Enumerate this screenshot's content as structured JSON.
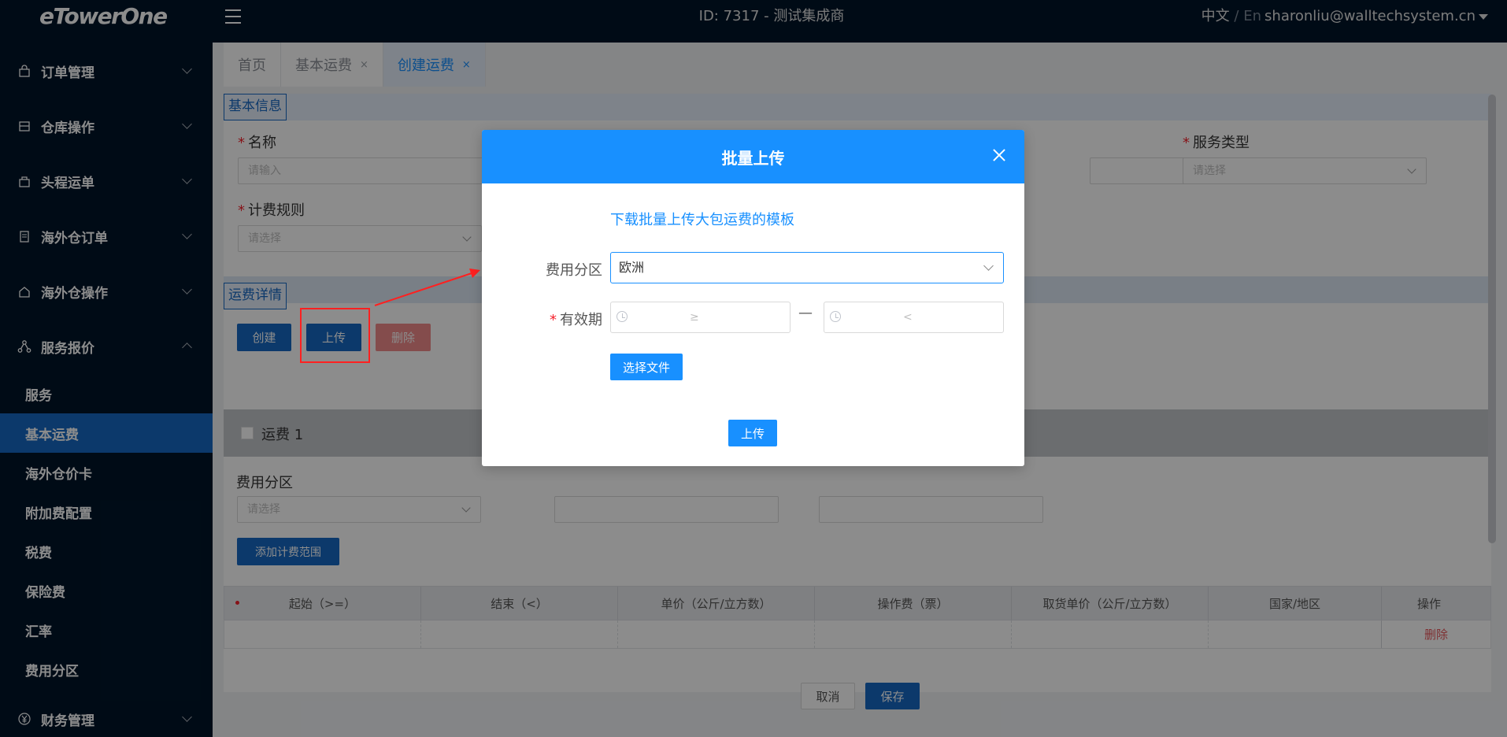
{
  "app": {
    "logo": "eTowerOne",
    "id_title": "ID: 7317 - 测试集成商"
  },
  "header": {
    "lang_zh": "中文",
    "lang_sep": "/",
    "lang_en": "En",
    "user_email": "sharonliu@walltechsystem.cn"
  },
  "sidebar": {
    "items": [
      {
        "label": "订单管理",
        "icon": "lock-icon"
      },
      {
        "label": "仓库操作",
        "icon": "box-icon"
      },
      {
        "label": "头程运单",
        "icon": "bag-icon"
      },
      {
        "label": "海外仓订单",
        "icon": "document-icon"
      },
      {
        "label": "海外仓操作",
        "icon": "house-icon"
      },
      {
        "label": "服务报价",
        "icon": "network-icon"
      }
    ],
    "subitems": [
      "服务",
      "基本运费",
      "海外仓价卡",
      "附加费配置",
      "税费",
      "保险费",
      "汇率",
      "费用分区"
    ],
    "active_subitem": "基本运费",
    "bottom_item": {
      "label": "财务管理",
      "icon": "yen-icon"
    }
  },
  "tabs": [
    {
      "label": "首页",
      "closable": false
    },
    {
      "label": "基本运费",
      "closable": true
    },
    {
      "label": "创建运费",
      "closable": true,
      "active": true
    }
  ],
  "close_glyph": "×",
  "form": {
    "basic_info_title": "基本信息",
    "name_label": "名称",
    "name_placeholder": "请输入",
    "service_type_label": "服务类型",
    "service_type_placeholder": "请选择",
    "billing_rule_label": "计费规则",
    "billing_rule_placeholder": "请选择",
    "required_mark": "*"
  },
  "freight": {
    "section_title": "运费详情",
    "create_btn": "创建",
    "upload_btn": "上传",
    "delete_btn": "删除",
    "freight_item": "运费 1",
    "zone_label": "费用分区",
    "zone_placeholder": "请选择",
    "add_range_btn": "添加计费范围",
    "columns": [
      "起始（>=）",
      "结束（<）",
      "单价（公斤/立方数）",
      "操作费（票）",
      "取货单价（公斤/立方数）",
      "国家/地区",
      "操作"
    ],
    "row_delete": "删除"
  },
  "footer": {
    "cancel_btn": "取消",
    "save_btn": "保存"
  },
  "modal": {
    "title": "批量上传",
    "template_link": "下载批量上传大包运费的模板",
    "zone_label": "费用分区",
    "zone_value": "欧洲",
    "validity_label": "有效期",
    "start_placeholder": "≥",
    "end_placeholder": "<",
    "range_separator": "—",
    "choose_file_btn": "选择文件",
    "upload_btn": "上传"
  },
  "colors": {
    "sidebar_bg": "#001529",
    "primary": "#1890ff",
    "active": "#1669c4",
    "danger": "#f5222d",
    "annotation": "#ff2020"
  }
}
